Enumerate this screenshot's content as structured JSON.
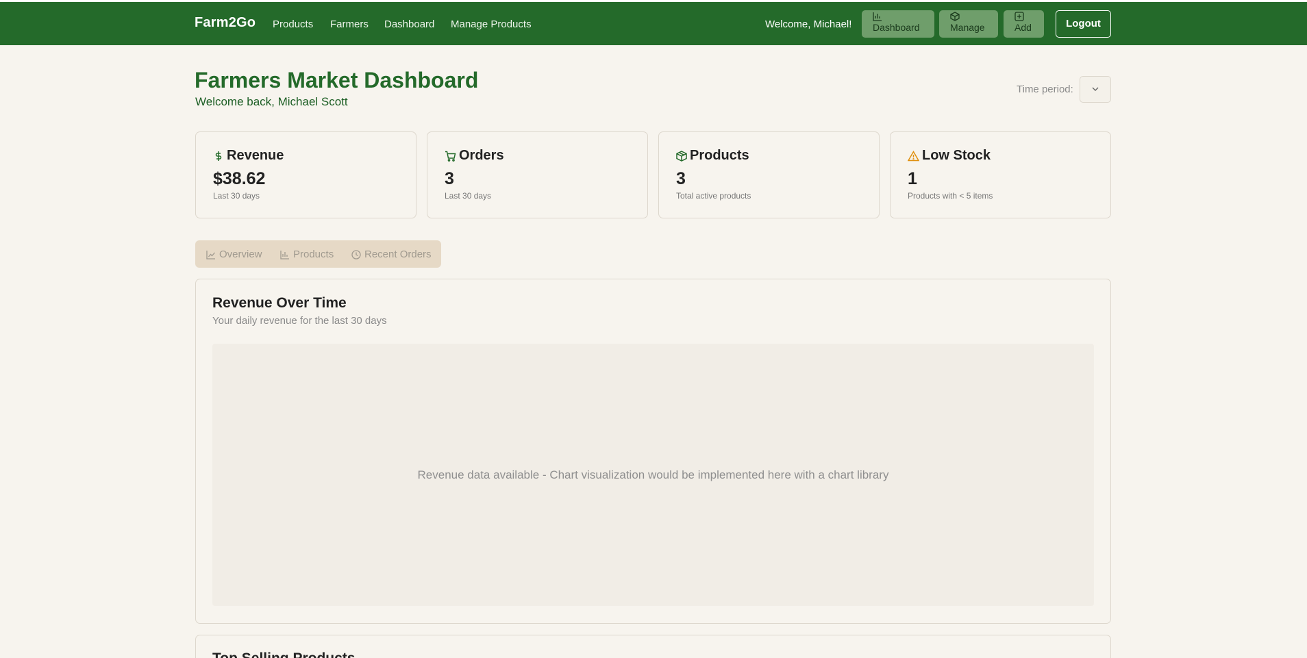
{
  "nav": {
    "brand": "Farm2Go",
    "links": [
      "Products",
      "Farmers",
      "Dashboard",
      "Manage Products"
    ],
    "welcome": "Welcome, Michael!",
    "buttons": [
      {
        "label": "Dashboard",
        "icon": "bar-chart-icon"
      },
      {
        "label": "Manage",
        "icon": "package-icon"
      },
      {
        "label": "Add",
        "icon": "plus-square-icon"
      }
    ],
    "logout": "Logout"
  },
  "header": {
    "title": "Farmers Market Dashboard",
    "subtitle": "Welcome back, Michael Scott",
    "time_label": "Time period:",
    "time_value": ""
  },
  "cards": [
    {
      "title": "Revenue",
      "value": "$38.62",
      "note": "Last 30 days",
      "icon": "dollar-icon",
      "icon_color": "#246a2a"
    },
    {
      "title": "Orders",
      "value": "3",
      "note": "Last 30 days",
      "icon": "cart-icon",
      "icon_color": "#246a2a"
    },
    {
      "title": "Products",
      "value": "3",
      "note": "Total active products",
      "icon": "package-icon",
      "icon_color": "#246a2a"
    },
    {
      "title": "Low Stock",
      "value": "1",
      "note": "Products with < 5 items",
      "icon": "warning-icon",
      "icon_color": "#e0900f"
    }
  ],
  "tabs": [
    {
      "label": "Overview",
      "icon": "line-chart-icon"
    },
    {
      "label": "Products",
      "icon": "bar-chart-icon"
    },
    {
      "label": "Recent Orders",
      "icon": "clock-icon"
    }
  ],
  "revenue_panel": {
    "title": "Revenue Over Time",
    "subtitle": "Your daily revenue for the last 30 days",
    "placeholder": "Revenue data available - Chart visualization would be implemented here with a chart library"
  },
  "top_selling": {
    "title": "Top Selling Products"
  },
  "colors": {
    "brand_green": "#246a2a",
    "background": "#f7f4ee",
    "tab_bg": "#e6d9c6",
    "warning": "#e0900f"
  }
}
